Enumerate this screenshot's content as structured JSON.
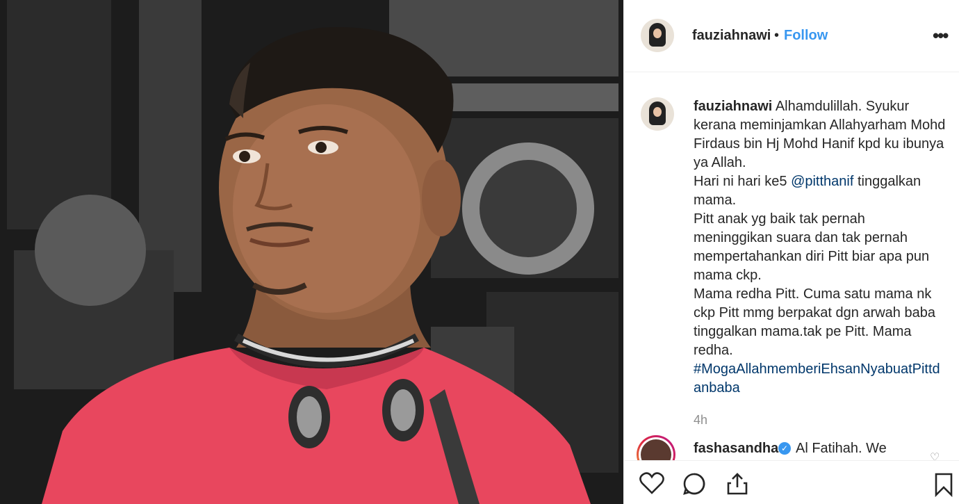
{
  "header": {
    "username": "fauziahnawi",
    "separator": "•",
    "follow_label": "Follow",
    "more_icon": "more-options-icon"
  },
  "caption": {
    "username": "fauziahnawi",
    "text_1": "Alhamdulillah. Syukur kerana meminjamkan Allahyarham Mohd Firdaus bin Hj Mohd Hanif kpd ku ibunya ya Allah.",
    "text_2a": "Hari ni hari ke5 ",
    "mention": "@pitthanif",
    "text_2b": " tinggalkan mama.",
    "text_3": "Pitt anak yg baik tak pernah meninggikan suara dan tak pernah mempertahankan diri Pitt biar apa pun mama ckp.",
    "text_4": "Mama redha Pitt. Cuma satu mama nk ckp Pitt mmg berpakat dgn arwah baba tinggalkan mama.tak pe Pitt. Mama redha.",
    "hashtag": "#MogaAllahmemberiEhsanNyabuatPittdanbaba",
    "timestamp": "4h"
  },
  "comment": {
    "username": "fashasandha",
    "verified_icon": "verified-badge-icon",
    "text": "Al Fatihah. We"
  },
  "actions": {
    "like_icon": "heart-icon",
    "comment_icon": "comment-icon",
    "share_icon": "share-icon",
    "save_icon": "bookmark-icon"
  },
  "colors": {
    "link": "#3897f0",
    "mention": "#00376b",
    "muted": "#8e8e8e",
    "shirt": "#e8475e"
  }
}
